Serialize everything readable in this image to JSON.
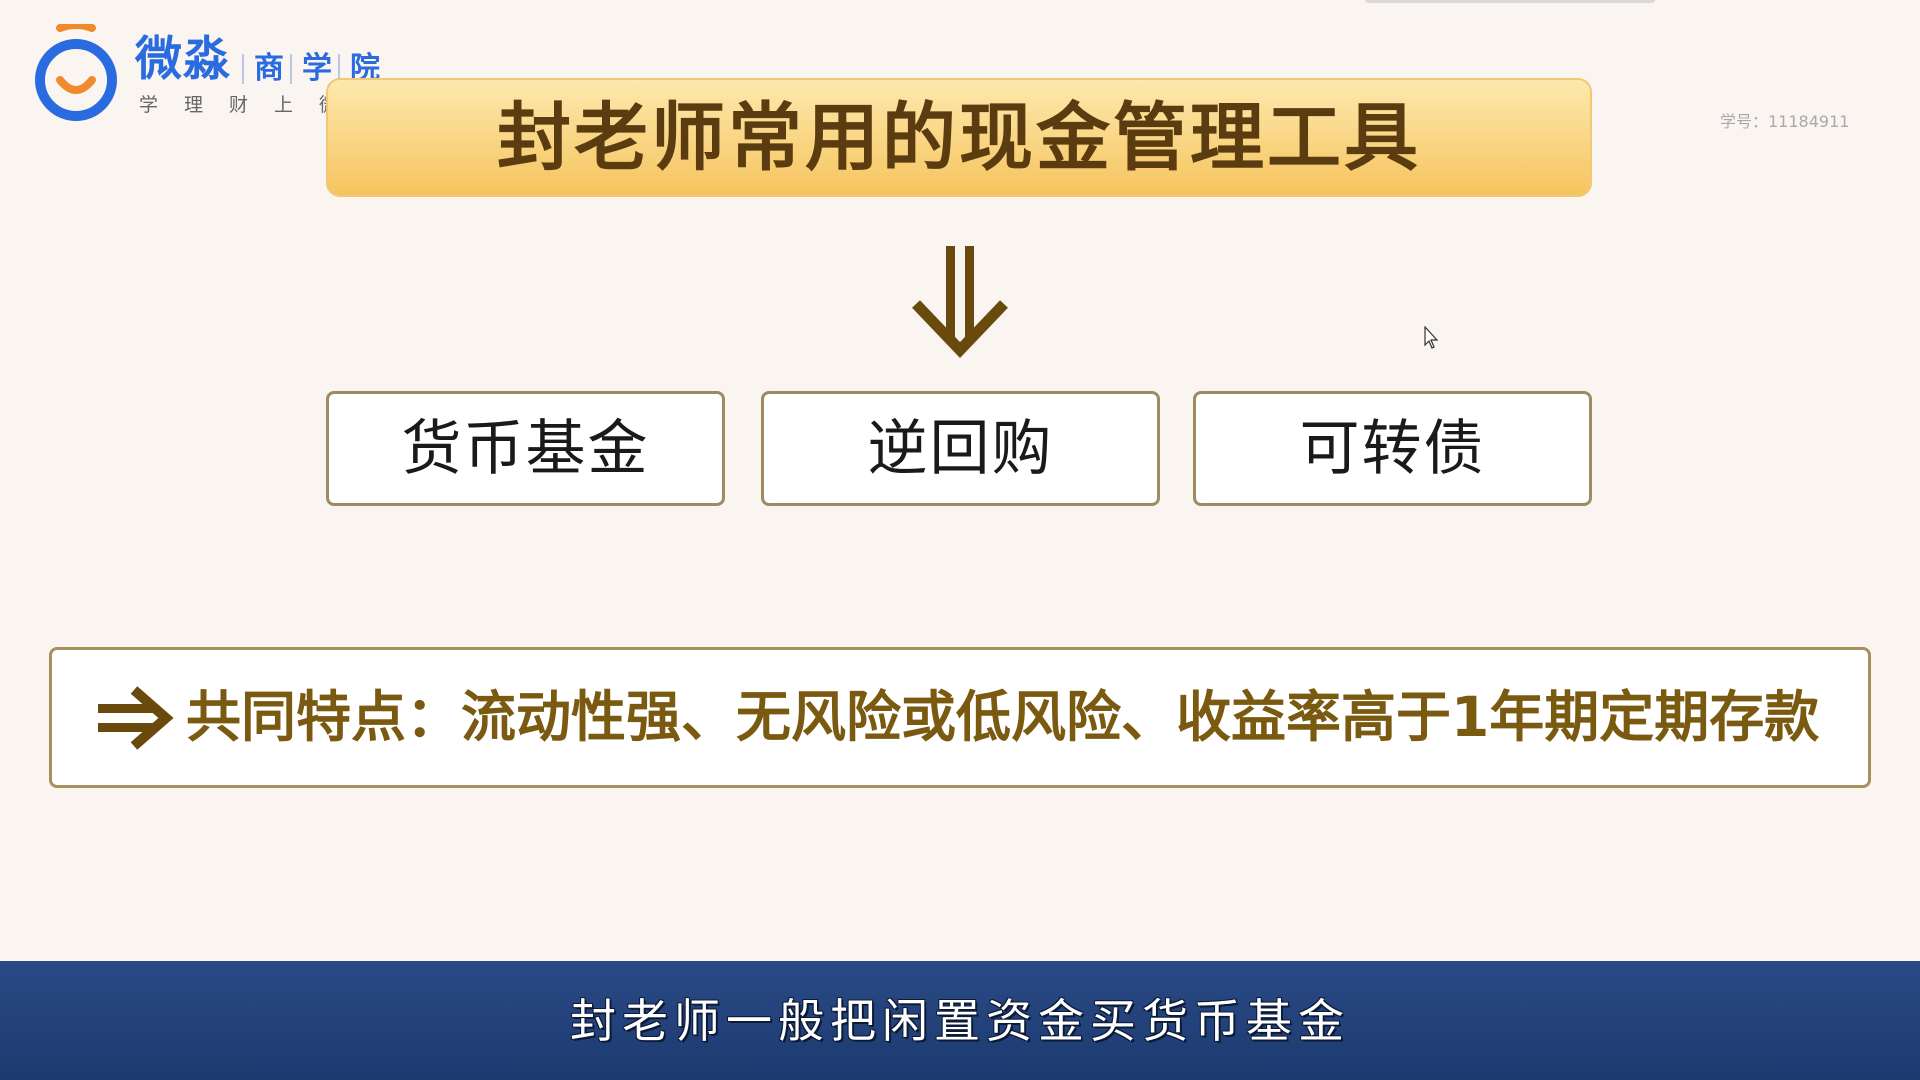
{
  "logo": {
    "brand": "微淼",
    "sub1": "商",
    "sub2": "学",
    "sub3": "院",
    "slogan": "学理财上微淼",
    "icon": "smile-ring-logo-icon"
  },
  "student_id": "学号：11184911",
  "title": "封老师常用的现金管理工具",
  "arrow_icon": "double-down-arrow-icon",
  "tools": [
    "货币基金",
    "逆回购",
    "可转债"
  ],
  "feature": {
    "icon": "double-right-arrow-icon",
    "text": "共同特点：流动性强、无风险或低风险、收益率高于1年期定期存款"
  },
  "subtitle": "封老师一般把闲置资金买货币基金",
  "colors": {
    "background": "#fbf5f2",
    "brand_blue": "#2b6be0",
    "brand_orange": "#f08a2c",
    "banner_gold": "#f6c45e",
    "title_brown": "#5b3c10",
    "accent_brown": "#7a5a10",
    "subtitle_bar": "#1d3a70"
  }
}
